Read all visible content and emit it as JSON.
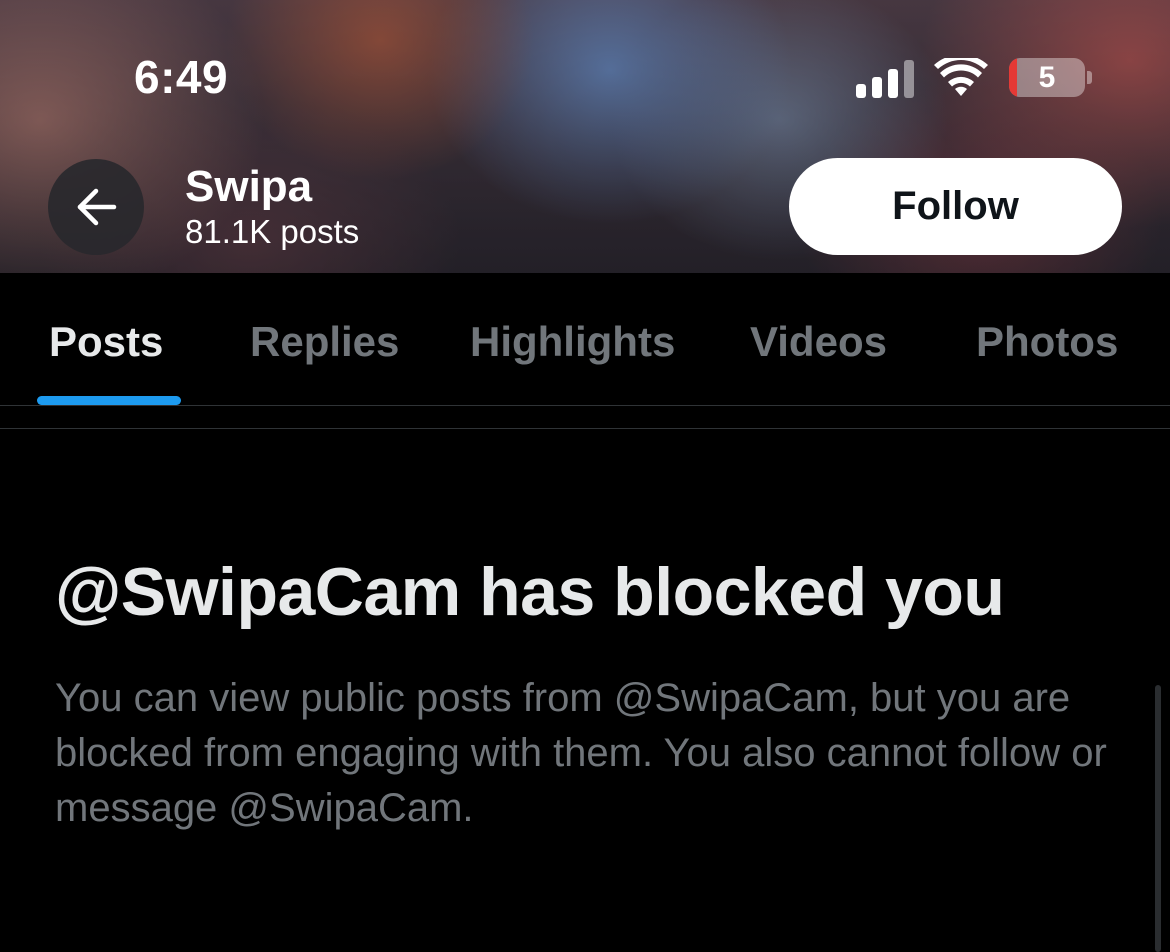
{
  "status_bar": {
    "time": "6:49",
    "battery_level": "5",
    "battery_fill_fraction": 0.05,
    "icons": [
      "signal-icon",
      "wifi-icon",
      "battery-icon"
    ]
  },
  "header": {
    "back_icon": "arrow-left-icon",
    "profile_name": "Swipa",
    "post_count": "81.1K posts",
    "follow_label": "Follow"
  },
  "tabs": [
    {
      "label": "Posts",
      "active": true
    },
    {
      "label": "Replies",
      "active": false
    },
    {
      "label": "Highlights",
      "active": false
    },
    {
      "label": "Videos",
      "active": false
    },
    {
      "label": "Photos",
      "active": false
    }
  ],
  "blocked": {
    "title": "@SwipaCam has blocked you",
    "body": "You can view public posts from @SwipaCam, but you are blocked from engaging with them. You also cannot follow or message @SwipaCam."
  },
  "colors": {
    "background": "#000000",
    "accent": "#1d9bf0",
    "muted_text": "#71767b",
    "primary_text": "#e7e9ea",
    "battery_low": "#e53935"
  }
}
